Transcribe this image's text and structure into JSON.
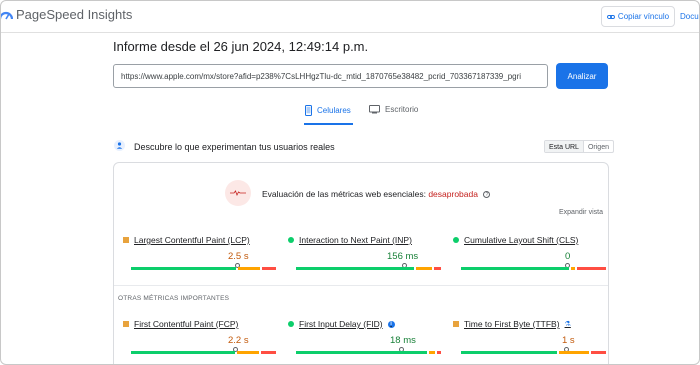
{
  "header": {
    "app_title": "PageSpeed Insights",
    "copy_link_label": "Copiar vínculo",
    "docs_label": "Docu"
  },
  "report": {
    "title": "Informe desde el 26 jun 2024, 12:49:14 p.m.",
    "url_value": "https://www.apple.com/mx/store?afid=p238%7CsLHHgzTlu-dc_mtid_1870765e38482_pcrid_703367187339_pgri",
    "analyze_label": "Analizar"
  },
  "tabs": [
    {
      "label": "Celulares",
      "icon": "phone-icon",
      "active": true
    },
    {
      "label": "Escritorio",
      "icon": "desktop-icon",
      "active": false
    }
  ],
  "discover": {
    "text": "Descubre lo que experimentan tus usuarios reales",
    "toggle_url": "Esta URL",
    "toggle_origin": "Origen"
  },
  "assessment": {
    "prefix": "Evaluación de las métricas web esenciales:",
    "result": "desaprobada",
    "expand_label": "Expandir vista"
  },
  "core_metrics": [
    {
      "name": "Largest Contentful Paint (LCP)",
      "value": "2.5 s",
      "status": "needs-improvement"
    },
    {
      "name": "Interaction to Next Paint (INP)",
      "value": "156 ms",
      "status": "good"
    },
    {
      "name": "Cumulative Layout Shift (CLS)",
      "value": "0",
      "status": "good"
    }
  ],
  "other_metrics_label": "OTRAS MÉTRICAS IMPORTANTES",
  "other_metrics": [
    {
      "name": "First Contentful Paint (FCP)",
      "value": "2.2 s",
      "status": "needs-improvement"
    },
    {
      "name": "First Input Delay (FID)",
      "value": "18 ms",
      "status": "good",
      "icon": "info-icon"
    },
    {
      "name": "Time to First Byte (TTFB)",
      "value": "1 s",
      "status": "needs-improvement",
      "icon": "flask-icon"
    }
  ],
  "colors": {
    "accent": "#1a73e8",
    "good": "#0cce6b",
    "average": "#ffa400",
    "poor": "#ff4e42",
    "fail_text": "#c5221f"
  }
}
